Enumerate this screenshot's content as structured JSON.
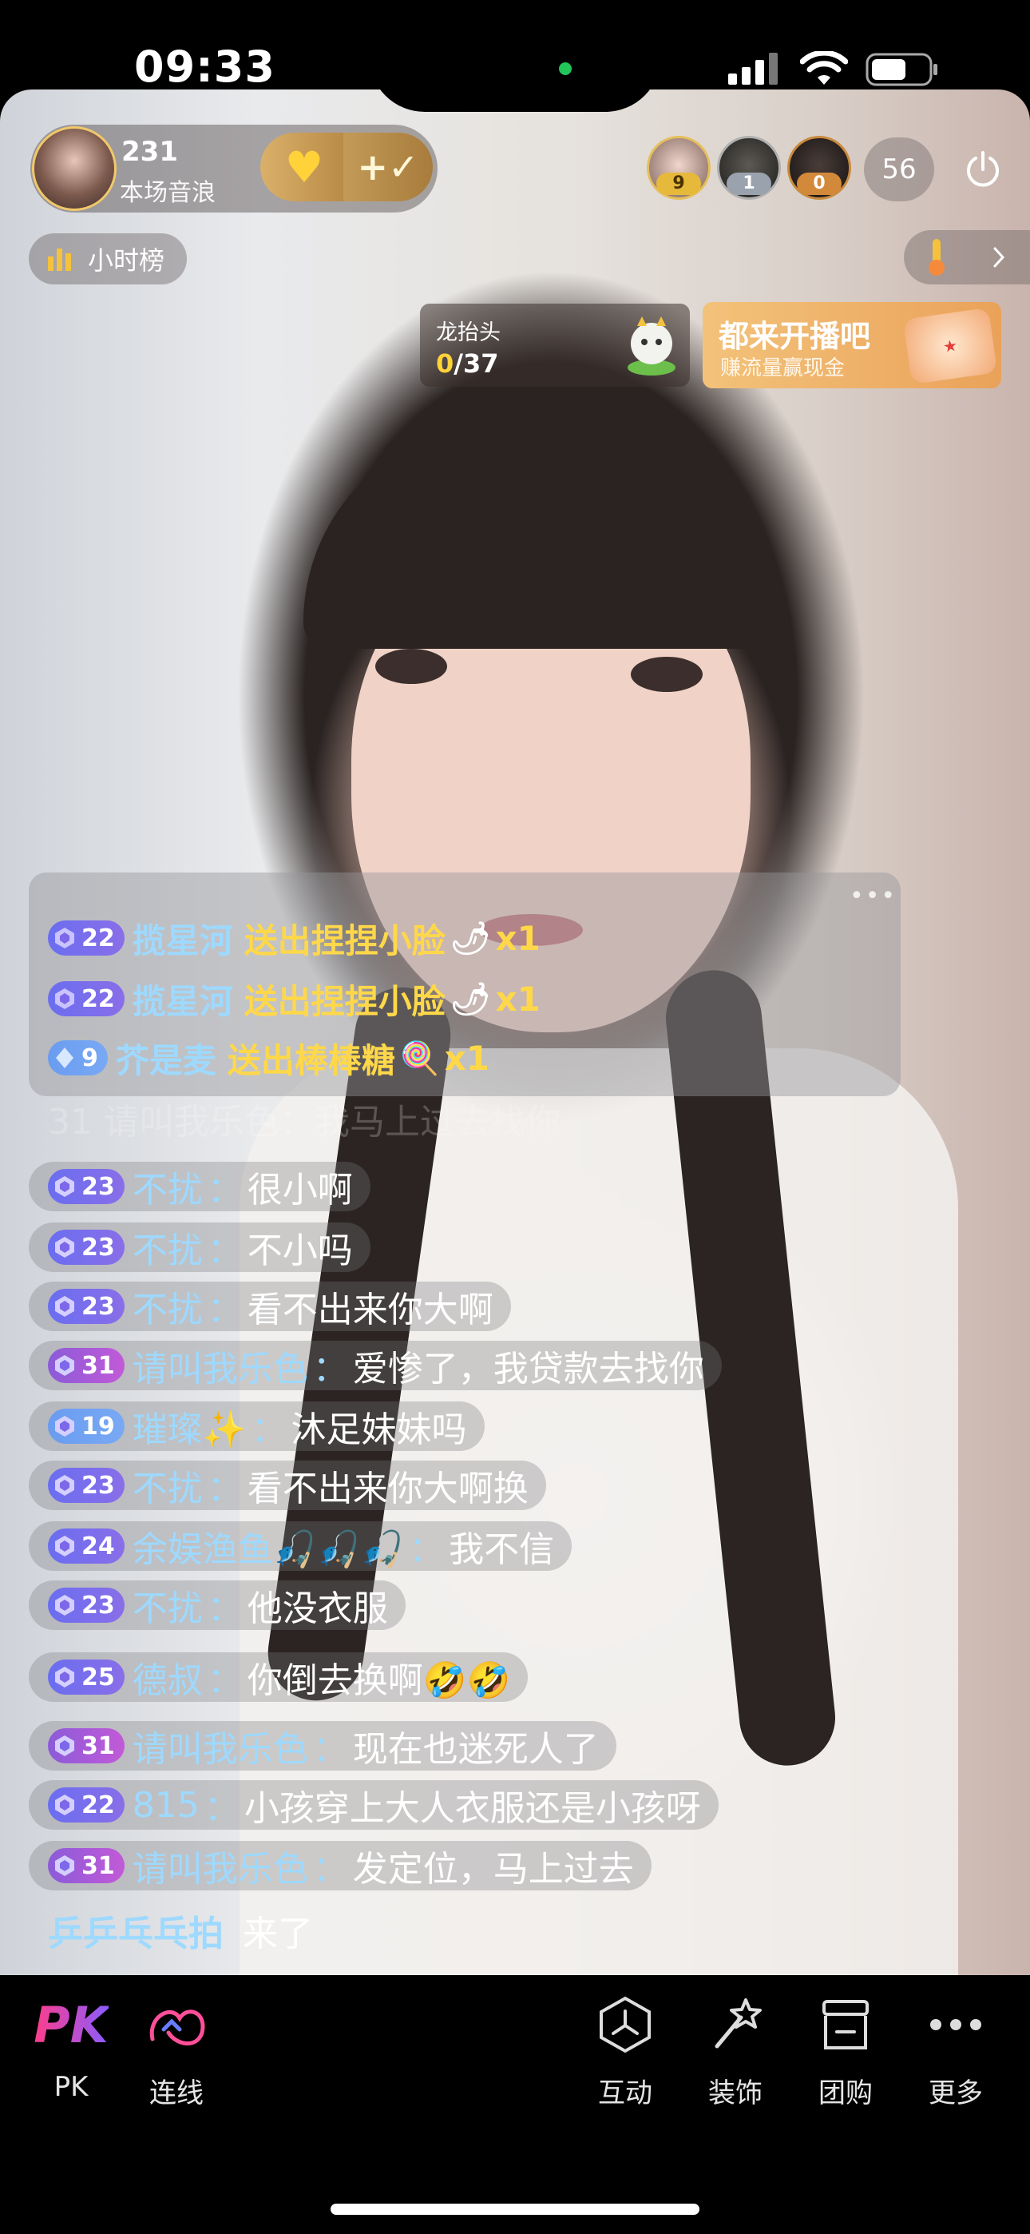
{
  "status_bar": {
    "time": "09:33"
  },
  "host": {
    "count": "231",
    "subtitle": "本场音浪"
  },
  "viewers": {
    "badges": [
      "9",
      "1",
      "0"
    ],
    "count": "56"
  },
  "hour_rank": {
    "label": "小时榜"
  },
  "task_card": {
    "title": "龙抬头",
    "current": "0",
    "total": "/37"
  },
  "promo_card": {
    "title": "都来开播吧",
    "subtitle": "赚流量赢现金"
  },
  "gift_messages": [
    {
      "level": "22",
      "user": "揽星河",
      "text": "送出捏捏小脸",
      "count": "x1"
    },
    {
      "level": "22",
      "user": "揽星河",
      "text": "送出捏捏小脸",
      "count": "x1"
    },
    {
      "level": "9",
      "user": "芥是麦",
      "text": "送出棒棒糖",
      "count": "x1"
    }
  ],
  "fading_message": {
    "level": "31",
    "user": "请叫我乐色",
    "text": "我马上过去找你"
  },
  "chat": [
    {
      "level": "23",
      "user": "不扰",
      "text": "很小啊"
    },
    {
      "level": "23",
      "user": "不扰",
      "text": "不小吗"
    },
    {
      "level": "23",
      "user": "不扰",
      "text": "看不出来你大啊"
    },
    {
      "level": "31",
      "user": "请叫我乐色",
      "text": "爱惨了，我贷款去找你"
    },
    {
      "level": "19",
      "user": "璀璨✨",
      "text": "沐足妹妹吗"
    },
    {
      "level": "23",
      "user": "不扰",
      "text": "看不出来你大啊换"
    },
    {
      "level": "24",
      "user": "余娱渔鱼🎣🎣🎣",
      "text": "我不信"
    },
    {
      "level": "23",
      "user": "不扰",
      "text": "他没衣服"
    },
    {
      "level": "25",
      "user": "德叔",
      "text": "你倒去换啊🤣🤣"
    },
    {
      "level": "31",
      "user": "请叫我乐色",
      "text": "现在也迷死人了"
    },
    {
      "level": "22",
      "user": "815",
      "text": "小孩穿上大人衣服还是小孩呀"
    },
    {
      "level": "31",
      "user": "请叫我乐色",
      "text": "发定位，马上过去"
    }
  ],
  "enter_message": {
    "user": "乒乒乓乓拍",
    "action": "来了"
  },
  "toolbar": {
    "pk": "PK",
    "link": "连线",
    "interact": "互动",
    "decorate": "装饰",
    "group_buy": "团购",
    "more": "更多"
  },
  "colors": {
    "accent_gold": "#ffd84a",
    "username_blue": "#9ed9ff",
    "pk_gradient": "#e0408f"
  }
}
